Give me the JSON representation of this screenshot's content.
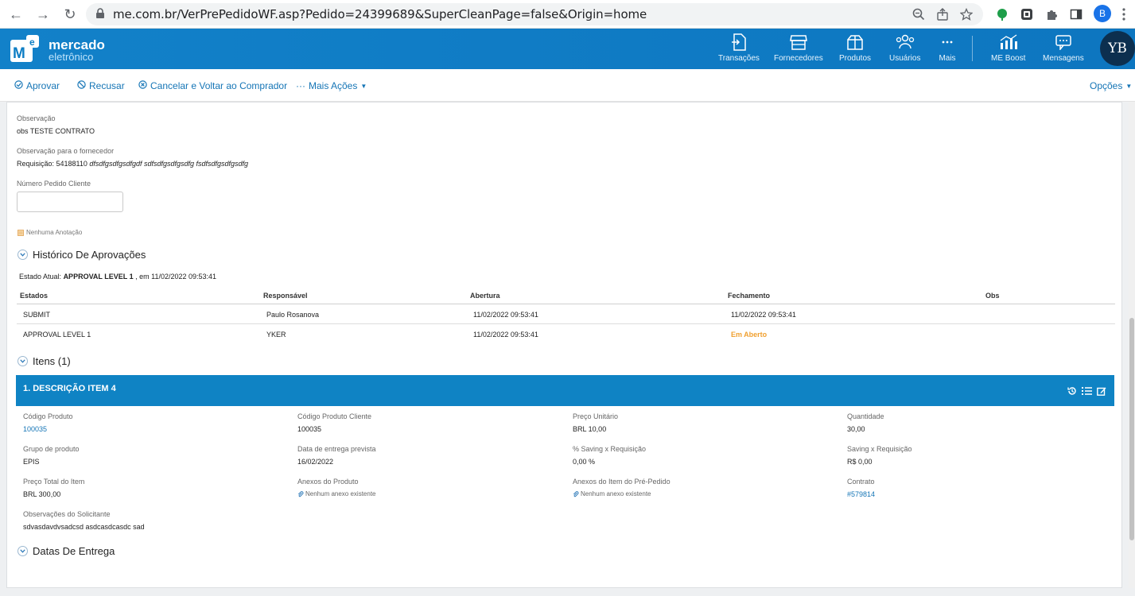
{
  "browser": {
    "url": "me.com.br/VerPrePedidoWF.asp?Pedido=24399689&SuperCleanPage=false&Origin=home",
    "profile_initial": "B"
  },
  "header": {
    "logo_line1": "mercado",
    "logo_line2": "eletrônico",
    "logo_mark": "Me",
    "nav": [
      {
        "label": "Transações",
        "icon": "transactions-icon"
      },
      {
        "label": "Fornecedores",
        "icon": "store-icon"
      },
      {
        "label": "Produtos",
        "icon": "box-icon"
      },
      {
        "label": "Usuários",
        "icon": "users-icon"
      },
      {
        "label": "Mais",
        "icon": "more-icon"
      },
      {
        "label": "ME Boost",
        "icon": "chart-icon"
      },
      {
        "label": "Mensagens",
        "icon": "message-icon"
      }
    ],
    "avatar_initials": "YB",
    "brand_color": "#0d7dc4"
  },
  "toolbar": {
    "approve": "Aprovar",
    "refuse": "Recusar",
    "cancel_return": "Cancelar e Voltar ao Comprador",
    "more_actions": "Mais Ações",
    "options": "Opções"
  },
  "details": {
    "observation_label": "Observação",
    "observation_value": "obs TESTE CONTRATO",
    "supplier_obs_label": "Observação para o fornecedor",
    "supplier_obs_prefix": "Requisição: 54188110",
    "supplier_obs_italic": "dfsdfgsdfgsdfgdf sdfsdfgsdfgsdfg fsdfsdfgsdfgsdfg",
    "client_order_label": "Número Pedido Cliente",
    "client_order_value": "",
    "annotation": "Nenhuma Anotação"
  },
  "approvals": {
    "title": "Histórico De Aprovações",
    "state_label": "Estado Atual:",
    "state_value": "APPROVAL LEVEL 1",
    "state_date": ", em 11/02/2022 09:53:41",
    "columns": [
      "Estados",
      "Responsável",
      "Abertura",
      "Fechamento",
      "Obs"
    ],
    "rows": [
      {
        "estado": "SUBMIT",
        "responsavel": "Paulo Rosanova",
        "abertura": "11/02/2022 09:53:41",
        "fechamento": "11/02/2022 09:53:41",
        "obs": ""
      },
      {
        "estado": "APPROVAL LEVEL 1",
        "responsavel": "YKER",
        "abertura": "11/02/2022 09:53:41",
        "fechamento": "Em Aberto",
        "obs": ""
      }
    ],
    "open_color": "#f0a030"
  },
  "items": {
    "title": "Itens (1)",
    "item_title": "1. DESCRIÇÃO ITEM 4",
    "fields": {
      "codigo_produto_label": "Código Produto",
      "codigo_produto": "100035",
      "codigo_cliente_label": "Código Produto Cliente",
      "codigo_cliente": "100035",
      "preco_unitario_label": "Preço Unitário",
      "preco_unitario": "BRL 10,00",
      "quantidade_label": "Quantidade",
      "quantidade": "30,00",
      "grupo_label": "Grupo de produto",
      "grupo": "EPIS",
      "data_entrega_label": "Data de entrega prevista",
      "data_entrega": "16/02/2022",
      "saving_pct_label": "% Saving x Requisição",
      "saving_pct": "0,00 %",
      "saving_label": "Saving x Requisição",
      "saving": "R$ 0,00",
      "preco_total_label": "Preço Total do Item",
      "preco_total": "BRL 300,00",
      "anexos_produto_label": "Anexos do Produto",
      "anexos_produto": "Nenhum anexo existente",
      "anexos_item_label": "Anexos do Item do Pré-Pedido",
      "anexos_item": "Nenhum anexo existente",
      "contrato_label": "Contrato",
      "contrato": "#579814",
      "obs_solicitante_label": "Observações do Solicitante",
      "obs_solicitante": "sdvasdavdvsadcsd asdcasdcasdc sad"
    }
  },
  "delivery": {
    "title": "Datas De Entrega"
  }
}
